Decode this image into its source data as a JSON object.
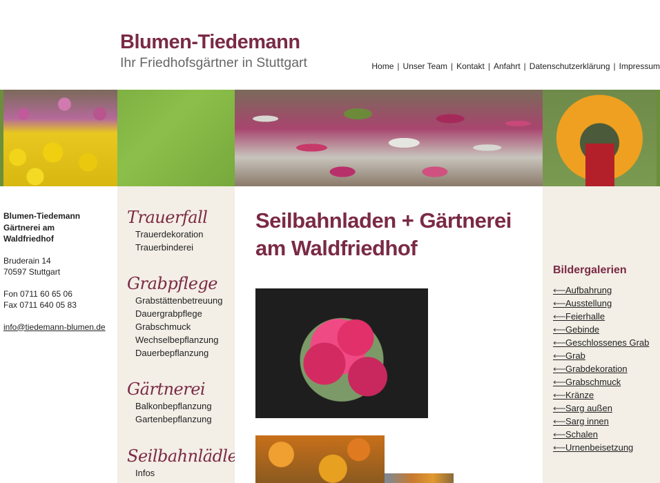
{
  "header": {
    "logo_title": "Blumen-Tiedemann",
    "logo_subtitle": "Ihr Friedhofsgärtner in Stuttgart"
  },
  "topnav": [
    {
      "label": "Home"
    },
    {
      "label": "Unser Team"
    },
    {
      "label": "Kontakt"
    },
    {
      "label": "Anfahrt"
    },
    {
      "label": "Datenschutzerklärung"
    },
    {
      "label": "Impressum"
    }
  ],
  "address": {
    "name_line1": "Blumen-Tiedemann",
    "name_line2": "Gärtnerei am",
    "name_line3": "Waldfriedhof",
    "street": "Bruderain 14",
    "city": "70597 Stuttgart",
    "phone": "Fon 0711 60 65 06",
    "fax": "Fax 0711 640 05 83",
    "email": "info@tiedemann-blumen.de"
  },
  "sidenav": [
    {
      "heading": "Trauerfall",
      "links": [
        "Trauerdekoration",
        "Trauerbinderei"
      ]
    },
    {
      "heading": "Grabpflege",
      "links": [
        "Grabstättenbetreuung",
        "Dauergrabpflege",
        "Grabschmuck",
        "Wechselbepflanzung",
        "Dauerbepflanzung"
      ]
    },
    {
      "heading": "Gärtnerei",
      "links": [
        "Balkonbepflanzung",
        "Gartenbepflanzung"
      ]
    },
    {
      "heading": "Seilbahnlädle",
      "links": [
        "Infos"
      ]
    }
  ],
  "main": {
    "title": "Seilbahnladen + Gärtnerei am Waldfriedhof"
  },
  "gallery": {
    "title": "Bildergalerien",
    "arrow": "⟵",
    "items": [
      "Aufbahrung",
      "Ausstellung",
      "Feierhalle",
      "Gebinde",
      "Geschlossenes Grab",
      "Grab",
      "Grabdekoration",
      "Grabschmuck",
      "Kränze",
      "Sarg außen",
      "Sarg innen",
      "Schalen",
      "Urnenbeisetzung"
    ]
  },
  "colors": {
    "brand": "#7a2a45",
    "nav_bg": "#f3eee6"
  }
}
